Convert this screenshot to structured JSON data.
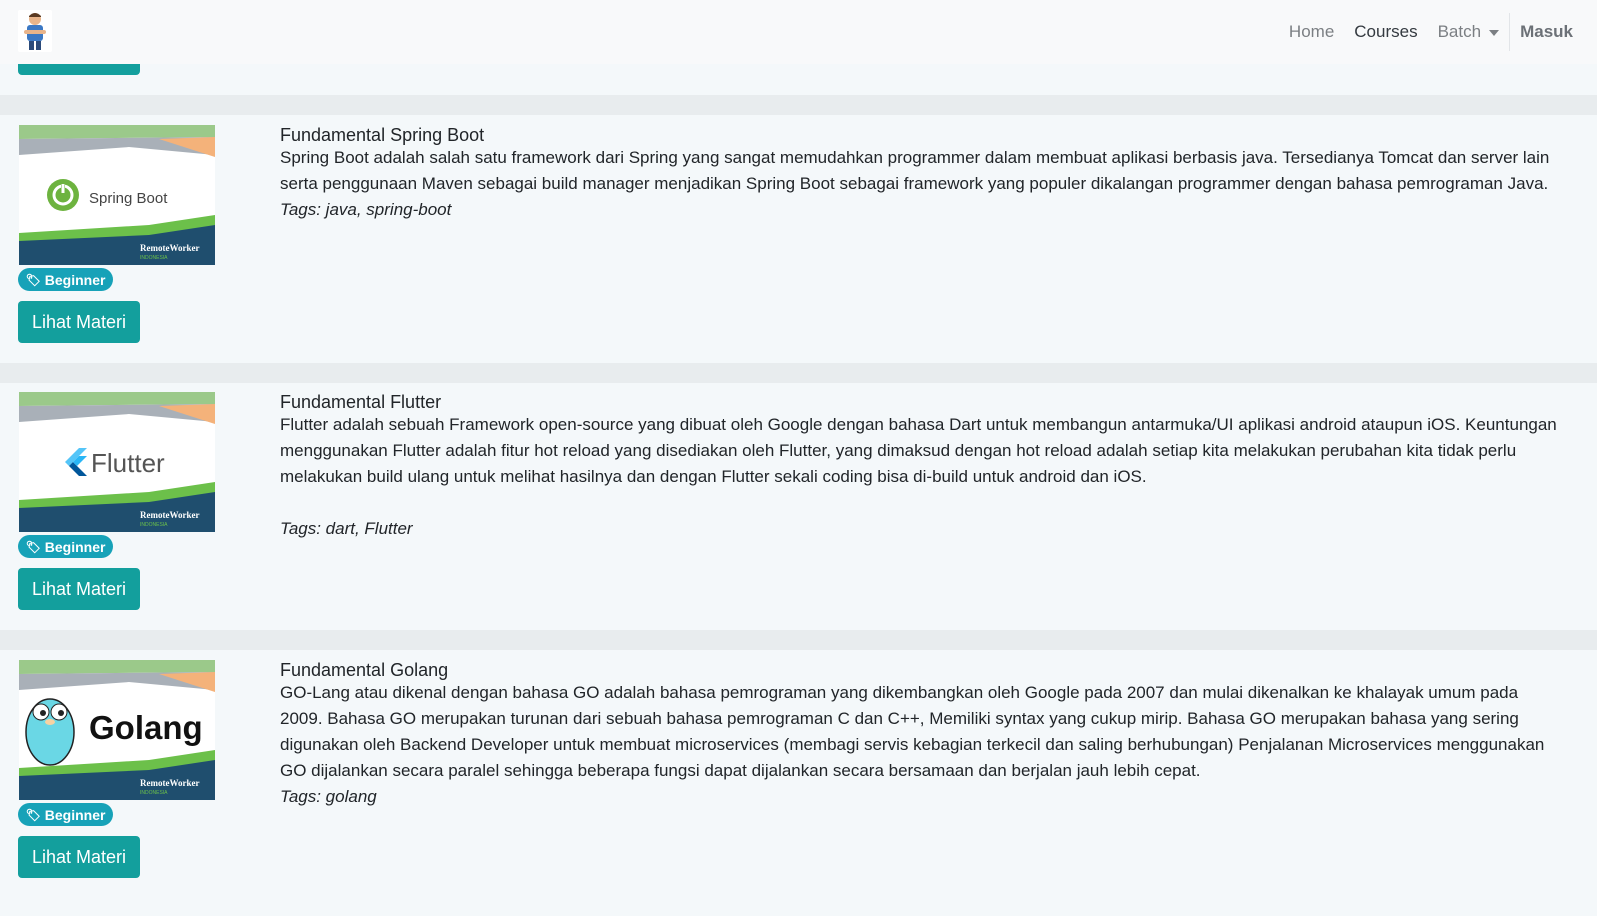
{
  "nav": {
    "home": "Home",
    "courses": "Courses",
    "batch": "Batch",
    "login": "Masuk"
  },
  "courses": [
    {
      "title": "Fundamental Spring Boot",
      "description": "Spring Boot adalah salah satu framework dari Spring yang sangat memudahkan programmer dalam membuat aplikasi berbasis java. Tersedianya Tomcat dan server lain serta penggunaan Maven sebagai build manager menjadikan Spring Boot sebagai framework yang populer dikalangan programmer dengan bahasa pemrograman Java.",
      "tags": "Tags: java, spring-boot",
      "level": "Beginner",
      "button": "Lihat Materi",
      "thumb_text": "Spring Boot",
      "brand": "RemoteWorker",
      "brand_sub": "INDONESIA"
    },
    {
      "title": "Fundamental Flutter",
      "description": "Flutter adalah sebuah Framework open-source yang dibuat oleh Google dengan bahasa Dart untuk membangun antarmuka/UI aplikasi android ataupun iOS. Keuntungan menggunakan Flutter adalah fitur hot reload yang disediakan oleh Flutter, yang dimaksud dengan hot reload adalah setiap kita melakukan perubahan kita tidak perlu melakukan build ulang untuk melihat hasilnya dan dengan Flutter sekali coding bisa di-build untuk android dan iOS.",
      "tags": "Tags: dart, Flutter",
      "level": "Beginner",
      "button": "Lihat Materi",
      "thumb_text": "Flutter",
      "brand": "RemoteWorker",
      "brand_sub": "INDONESIA"
    },
    {
      "title": "Fundamental Golang",
      "description": "GO-Lang atau dikenal dengan bahasa GO adalah bahasa pemrograman yang dikembangkan oleh Google pada 2007 dan mulai dikenalkan ke khalayak umum pada 2009. Bahasa GO merupakan turunan dari sebuah bahasa pemrograman C dan C++, Memiliki syntax yang cukup mirip. Bahasa GO merupakan bahasa yang sering digunakan oleh Backend Developer untuk membuat microservices (membagi servis kebagian terkecil dan saling berhubungan) Penjalanan Microservices menggunakan GO dijalankan secara paralel sehingga beberapa fungsi dapat dijalankan secara bersamaan dan berjalan jauh lebih cepat.",
      "tags": "Tags: golang",
      "level": "Beginner",
      "button": "Lihat Materi",
      "thumb_text": "Golang",
      "brand": "RemoteWorker",
      "brand_sub": "INDONESIA"
    }
  ],
  "colors": {
    "primary_button": "#139f9d",
    "badge": "#17a2b8",
    "page_bg": "#f4f8fa"
  }
}
